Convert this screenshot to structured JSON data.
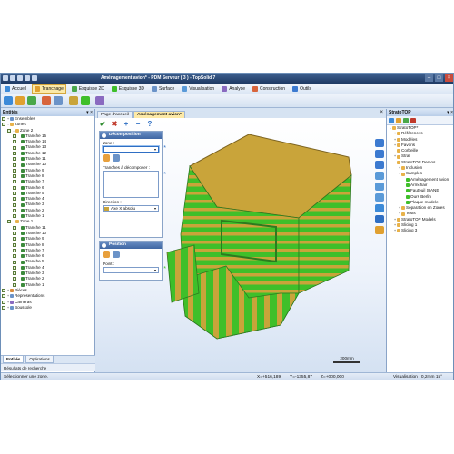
{
  "window": {
    "title": "Aménagement avion* - PDM Serveur ( 3 ) - TopSolid 7"
  },
  "menu": [
    {
      "label": "Accueil",
      "active": false
    },
    {
      "label": "Tranchage",
      "active": true
    },
    {
      "label": "Esquisse 2D",
      "active": false
    },
    {
      "label": "Esquisse 3D",
      "active": false
    },
    {
      "label": "Surface",
      "active": false
    },
    {
      "label": "Visualisation",
      "active": false
    },
    {
      "label": "Analyse",
      "active": false
    },
    {
      "label": "Construction",
      "active": false
    },
    {
      "label": "Outils",
      "active": false
    }
  ],
  "left_panel": {
    "title": "Entités",
    "tree": [
      {
        "label": "Ensembles",
        "level": 0,
        "expand": "+",
        "kind": "e"
      },
      {
        "label": "Zones",
        "level": 0,
        "expand": "-",
        "kind": "z"
      },
      {
        "label": "Zone 2",
        "level": 1,
        "expand": "-",
        "kind": "z"
      },
      {
        "label": "Tranche 15",
        "level": 2,
        "kind": "t"
      },
      {
        "label": "Tranche 14",
        "level": 2,
        "kind": "t"
      },
      {
        "label": "Tranche 13",
        "level": 2,
        "kind": "t"
      },
      {
        "label": "Tranche 12",
        "level": 2,
        "kind": "t"
      },
      {
        "label": "Tranche 11",
        "level": 2,
        "kind": "t"
      },
      {
        "label": "Tranche 10",
        "level": 2,
        "kind": "t"
      },
      {
        "label": "Tranche 9",
        "level": 2,
        "kind": "t"
      },
      {
        "label": "Tranche 8",
        "level": 2,
        "kind": "t"
      },
      {
        "label": "Tranche 7",
        "level": 2,
        "kind": "t"
      },
      {
        "label": "Tranche 6",
        "level": 2,
        "kind": "t"
      },
      {
        "label": "Tranche 5",
        "level": 2,
        "kind": "t"
      },
      {
        "label": "Tranche 4",
        "level": 2,
        "kind": "t"
      },
      {
        "label": "Tranche 3",
        "level": 2,
        "kind": "t"
      },
      {
        "label": "Tranche 2",
        "level": 2,
        "kind": "t"
      },
      {
        "label": "Tranche 1",
        "level": 2,
        "kind": "t"
      },
      {
        "label": "Zone 1",
        "level": 1,
        "expand": "-",
        "kind": "z"
      },
      {
        "label": "Tranche 11",
        "level": 2,
        "kind": "t"
      },
      {
        "label": "Tranche 10",
        "level": 2,
        "kind": "t"
      },
      {
        "label": "Tranche 9",
        "level": 2,
        "kind": "t"
      },
      {
        "label": "Tranche 8",
        "level": 2,
        "kind": "t"
      },
      {
        "label": "Tranche 7",
        "level": 2,
        "kind": "t"
      },
      {
        "label": "Tranche 6",
        "level": 2,
        "kind": "t"
      },
      {
        "label": "Tranche 5",
        "level": 2,
        "kind": "t"
      },
      {
        "label": "Tranche 4",
        "level": 2,
        "kind": "t"
      },
      {
        "label": "Tranche 3",
        "level": 2,
        "kind": "t"
      },
      {
        "label": "Tranche 2",
        "level": 2,
        "kind": "t"
      },
      {
        "label": "Tranche 1",
        "level": 2,
        "kind": "t"
      },
      {
        "label": "Pièces",
        "level": 0,
        "expand": "+",
        "kind": "p"
      },
      {
        "label": "Représentations",
        "level": 0,
        "expand": "+",
        "kind": "e"
      },
      {
        "label": "Caméras",
        "level": 0,
        "expand": "+",
        "kind": "c"
      },
      {
        "label": "Boussole",
        "level": 0,
        "expand": "+",
        "kind": "e"
      }
    ],
    "tabs": [
      {
        "label": "Entités",
        "active": true
      },
      {
        "label": "Opérations",
        "active": false
      }
    ],
    "search_label": "Résultats de recherche"
  },
  "doc_tabs": [
    {
      "label": "Page d'accueil",
      "active": false
    },
    {
      "label": "Aménagement avion*",
      "active": true
    }
  ],
  "dialog": {
    "decomposition": {
      "title": "Décomposition",
      "zone_label": "Zone :",
      "slices_label": "Tranches à décomposer :",
      "direction_label": "Direction :",
      "direction_value": "Axe X absolu"
    },
    "position": {
      "title": "Position",
      "point_label": "Point :"
    }
  },
  "viewport": {
    "scale_label": "200mm"
  },
  "right_panel": {
    "title": "StratoTOP",
    "tree": [
      {
        "label": "StratoTOP*",
        "level": 0,
        "expand": "-"
      },
      {
        "label": "Références",
        "level": 1,
        "expand": "+"
      },
      {
        "label": "Modèles",
        "level": 1,
        "expand": "+"
      },
      {
        "label": "Favoris",
        "level": 1,
        "expand": "+"
      },
      {
        "label": "Corbeille",
        "level": 1,
        "expand": ""
      },
      {
        "label": "Strat",
        "level": 1,
        "expand": "+"
      },
      {
        "label": "StratoTOP Demos",
        "level": 1,
        "expand": "-"
      },
      {
        "label": "Inclusion",
        "level": 2,
        "expand": "+"
      },
      {
        "label": "Samples",
        "level": 2,
        "expand": "-"
      },
      {
        "label": "Aménagement avion",
        "level": 3,
        "expand": ""
      },
      {
        "label": "Armchair",
        "level": 3,
        "expand": ""
      },
      {
        "label": "Fauteuil SIANE",
        "level": 3,
        "expand": ""
      },
      {
        "label": "Ours Berlin",
        "level": 3,
        "expand": ""
      },
      {
        "label": "Plaque modele",
        "level": 3,
        "expand": ""
      },
      {
        "label": "Séparation en Zones",
        "level": 2,
        "expand": "+"
      },
      {
        "label": "Tests",
        "level": 2,
        "expand": "+"
      },
      {
        "label": "StratoTOP Models",
        "level": 1,
        "expand": "+"
      },
      {
        "label": "Slicing   1",
        "level": 1,
        "expand": "+"
      },
      {
        "label": "Slicing   3",
        "level": 1,
        "expand": "+"
      }
    ]
  },
  "status": {
    "message": "Sélectionner une zone.",
    "x": "X=+516,189",
    "y": "Y=-1355,87",
    "z": "Z=+000,000",
    "visualisation": "Visualisation : 0,2mm 15°"
  },
  "colors": {
    "model_green": "#3fbf2a",
    "model_gold": "#c9a43a",
    "accent_blue": "#2f6fc4"
  }
}
